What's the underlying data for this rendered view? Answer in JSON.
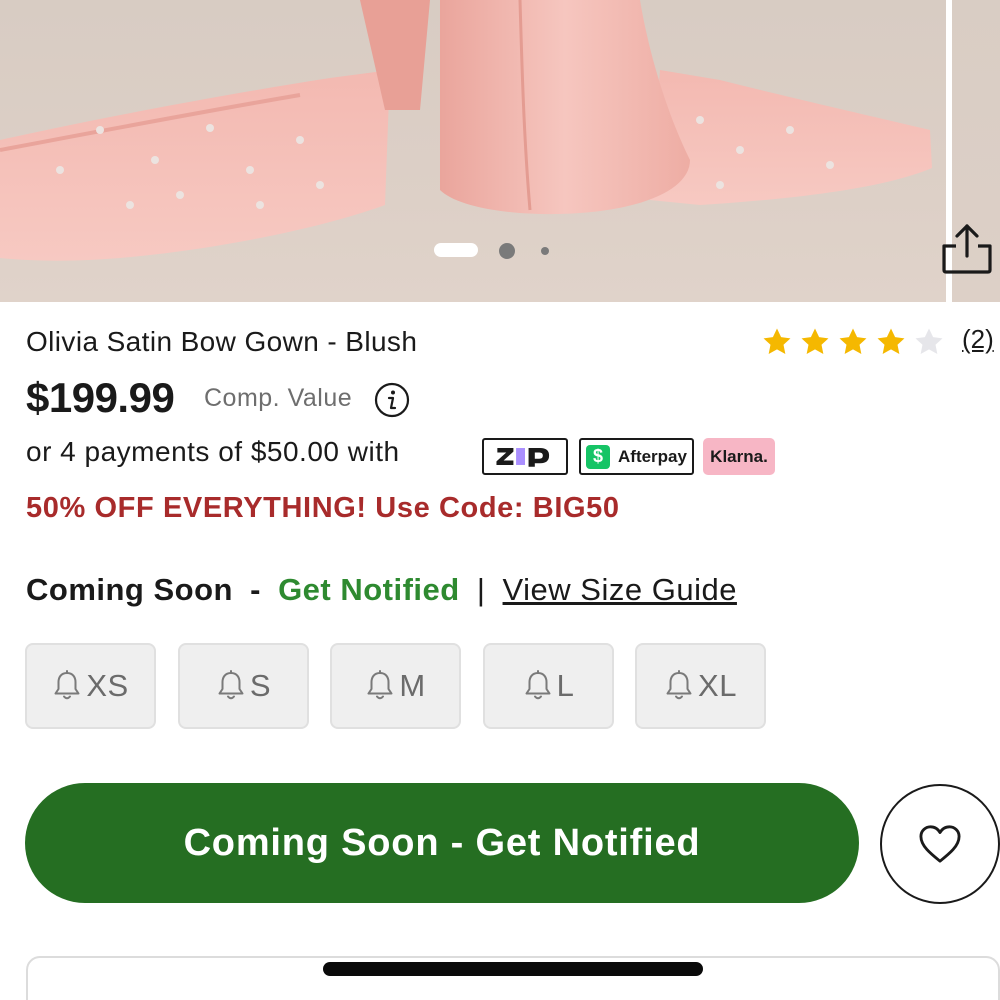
{
  "product": {
    "title": "Olivia Satin Bow Gown - Blush",
    "rating_stars": 4,
    "rating_max": 5,
    "review_count": "(2)",
    "price": "$199.99",
    "comp_value_label": "Comp. Value",
    "installments_text": "or 4 payments of $50.00 with",
    "promo_text": "50% OFF EVERYTHING! Use Code: BIG50"
  },
  "gallery": {
    "image_count": 3,
    "active_index": 0
  },
  "payment_providers": {
    "zip_label": "zip",
    "afterpay_label": "Afterpay",
    "afterpay_logo_symbol": "$",
    "klarna_label": "Klarna."
  },
  "availability": {
    "status": "Coming Soon",
    "dash": "-",
    "notify_label": "Get Notified",
    "separator": "|",
    "size_guide_label": "View Size Guide"
  },
  "sizes": [
    {
      "label": "XS",
      "icon": "bell-icon"
    },
    {
      "label": "S",
      "icon": "bell-icon"
    },
    {
      "label": "M",
      "icon": "bell-icon"
    },
    {
      "label": "L",
      "icon": "bell-icon"
    },
    {
      "label": "XL",
      "icon": "bell-icon"
    }
  ],
  "cta": {
    "label": "Coming Soon - Get Notified"
  },
  "icons": {
    "share": "share-icon",
    "info": "info-icon",
    "wishlist": "heart-icon",
    "star": "star-icon"
  },
  "colors": {
    "cta_green": "#256e22",
    "notify_green": "#2e8a30",
    "promo_red": "#a82b2b",
    "star_gold": "#f5b800",
    "klarna_pink": "#f7b6c5",
    "afterpay_green": "#16c466",
    "gown_blush": "#f2b7b0"
  }
}
